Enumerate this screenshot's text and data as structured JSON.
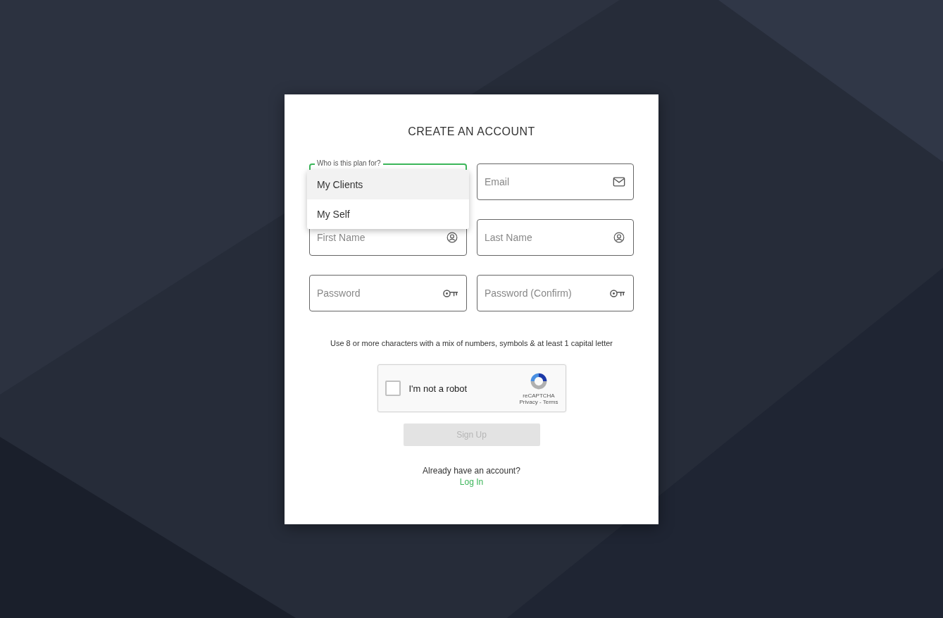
{
  "title": "CREATE AN ACCOUNT",
  "plan_select": {
    "label": "Who is this plan for?",
    "expanded": true,
    "options": [
      {
        "label": "My Clients",
        "selected": true
      },
      {
        "label": "My Self",
        "selected": false
      }
    ]
  },
  "fields": [
    {
      "placeholder": "Email",
      "kind": "email"
    },
    {
      "placeholder": "First Name",
      "kind": "name"
    },
    {
      "placeholder": "Last Name",
      "kind": "name"
    },
    {
      "placeholder": "Password",
      "kind": "password"
    },
    {
      "placeholder": "Password (Confirm)",
      "kind": "password"
    }
  ],
  "hint": "Use 8 or more characters with a mix of numbers, symbols & at least 1 capital letter",
  "captcha": {
    "label": "I'm not a robot",
    "checked": false,
    "brand": "reCAPTCHA",
    "links": "Privacy - Terms"
  },
  "submit": {
    "label": "Sign Up",
    "disabled": true
  },
  "footer": {
    "prompt": "Already have an account?",
    "link": "Log In"
  }
}
